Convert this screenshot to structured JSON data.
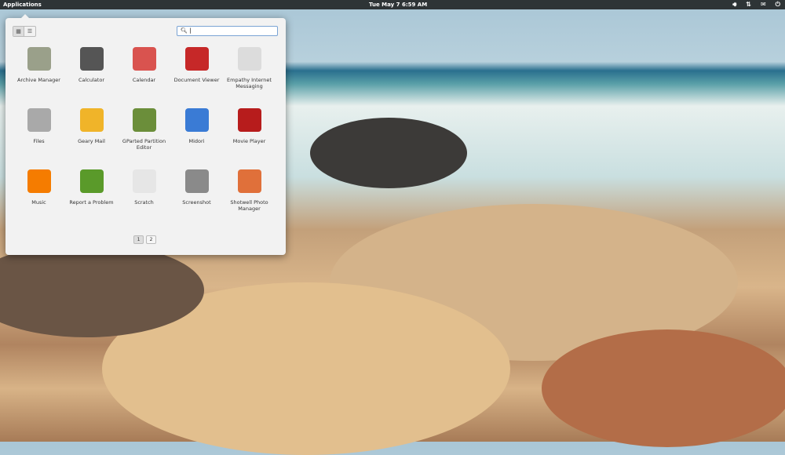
{
  "topbar": {
    "applications": "Applications",
    "clock": "Tue May  7  6:59 AM"
  },
  "tray": [
    "volume-icon",
    "network-icon",
    "mail-icon",
    "power-icon"
  ],
  "search": {
    "value": ""
  },
  "views": {
    "grid": "grid-view-icon",
    "list": "list-view-icon"
  },
  "apps": [
    {
      "label": "Archive Manager",
      "color": "#9aa08a"
    },
    {
      "label": "Calculator",
      "color": "#555"
    },
    {
      "label": "Calendar",
      "color": "#d9534f"
    },
    {
      "label": "Document Viewer",
      "color": "#c62828"
    },
    {
      "label": "Empathy Internet Messaging",
      "color": "#dcdcdc"
    },
    {
      "label": "Files",
      "color": "#a9a9a9"
    },
    {
      "label": "Geary Mail",
      "color": "#f0b429"
    },
    {
      "label": "GParted Partition Editor",
      "color": "#6b8e3a"
    },
    {
      "label": "Midori",
      "color": "#3a7bd5"
    },
    {
      "label": "Movie Player",
      "color": "#b71c1c"
    },
    {
      "label": "Music",
      "color": "#f57c00"
    },
    {
      "label": "Report a Problem",
      "color": "#5a9a2a"
    },
    {
      "label": "Scratch",
      "color": "#e6e6e6"
    },
    {
      "label": "Screenshot",
      "color": "#8a8a8a"
    },
    {
      "label": "Shotwell Photo Manager",
      "color": "#e0703a"
    }
  ],
  "pager": [
    "1",
    "2"
  ]
}
